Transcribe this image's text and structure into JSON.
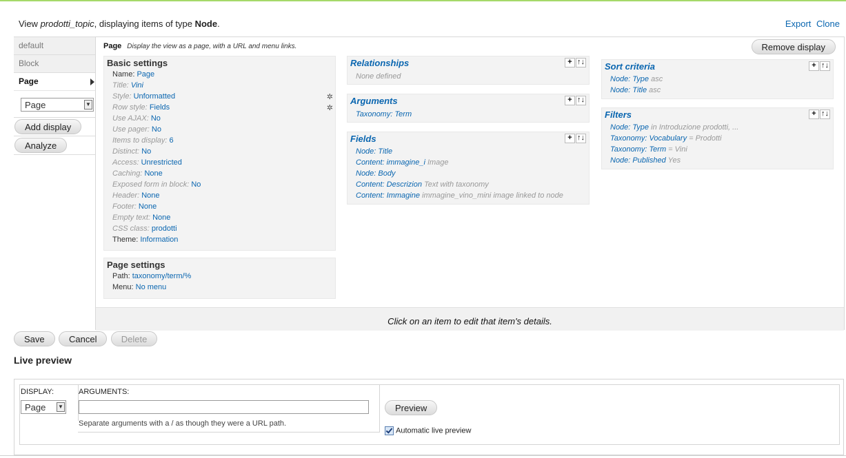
{
  "header": {
    "prefix": "View ",
    "view_name": "prodotti_topic",
    "mid": ", displaying items of type ",
    "type": "Node",
    "suffix": ".",
    "export_link": "Export",
    "clone_link": "Clone"
  },
  "tabs": {
    "default": "default",
    "block": "Block",
    "page": "Page",
    "select_value": "Page",
    "add_display": "Add display",
    "analyze": "Analyze"
  },
  "page_panel": {
    "name": "Page",
    "description": "Display the view as a page, with a URL and menu links.",
    "remove_display": "Remove display",
    "footer_hint": "Click on an item to edit that item's details."
  },
  "basic_settings": {
    "title": "Basic settings",
    "items": [
      {
        "key": "Name:",
        "value": "Page"
      },
      {
        "key": "Title:",
        "value": "Vini"
      },
      {
        "key": "Style:",
        "value": "Unformatted"
      },
      {
        "key": "Row style:",
        "value": "Fields"
      },
      {
        "key": "Use AJAX:",
        "value": "No"
      },
      {
        "key": "Use pager:",
        "value": "No"
      },
      {
        "key": "Items to display:",
        "value": "6"
      },
      {
        "key": "Distinct:",
        "value": "No"
      },
      {
        "key": "Access:",
        "value": "Unrestricted"
      },
      {
        "key": "Caching:",
        "value": "None"
      },
      {
        "key": "Exposed form in block:",
        "value": "No"
      },
      {
        "key": "Header:",
        "value": "None"
      },
      {
        "key": "Footer:",
        "value": "None"
      },
      {
        "key": "Empty text:",
        "value": "None"
      },
      {
        "key": "CSS class:",
        "value": "prodotti"
      },
      {
        "key": "Theme:",
        "value": "Information"
      }
    ]
  },
  "page_settings": {
    "title": "Page settings",
    "items": [
      {
        "key": "Path:",
        "value": "taxonomy/term/%"
      },
      {
        "key": "Menu:",
        "value": "No menu"
      }
    ]
  },
  "relationships": {
    "title": "Relationships",
    "empty": "None defined"
  },
  "arguments": {
    "title": "Arguments",
    "items": [
      {
        "key": "Taxonomy: Term",
        "extra": ""
      }
    ]
  },
  "fields": {
    "title": "Fields",
    "items": [
      {
        "key": "Node: Title",
        "extra": ""
      },
      {
        "key": "Content: immagine_i",
        "extra": "Image"
      },
      {
        "key": "Node: Body",
        "extra": ""
      },
      {
        "key": "Content: Descrizion",
        "extra": "Text with taxonomy"
      },
      {
        "key": "Content: Immagine",
        "extra": "immagine_vino_mini image linked to node"
      }
    ]
  },
  "sort_criteria": {
    "title": "Sort criteria",
    "items": [
      {
        "key": "Node: Type",
        "extra": "asc"
      },
      {
        "key": "Node: Title",
        "extra": "asc"
      }
    ]
  },
  "filters": {
    "title": "Filters",
    "items": [
      {
        "key": "Node: Type",
        "extra": "in Introduzione prodotti, ..."
      },
      {
        "key": "Taxonomy: Vocabulary",
        "extra": "= Prodotti"
      },
      {
        "key": "Taxonomy: Term",
        "extra": "= Vini"
      },
      {
        "key": "Node: Published",
        "extra": "Yes"
      }
    ]
  },
  "icons": {
    "add": "+",
    "rearrange": "↑↓",
    "gear": "✲"
  },
  "buttons": {
    "save": "Save",
    "cancel": "Cancel",
    "delete": "Delete"
  },
  "live_preview": {
    "title": "Live preview",
    "display_label": "DISPLAY:",
    "display_value": "Page",
    "arguments_label": "ARGUMENTS:",
    "arguments_value": "",
    "help": "Separate arguments with a / as though they were a URL path.",
    "preview_button": "Preview",
    "auto_label": "Automatic live preview"
  }
}
